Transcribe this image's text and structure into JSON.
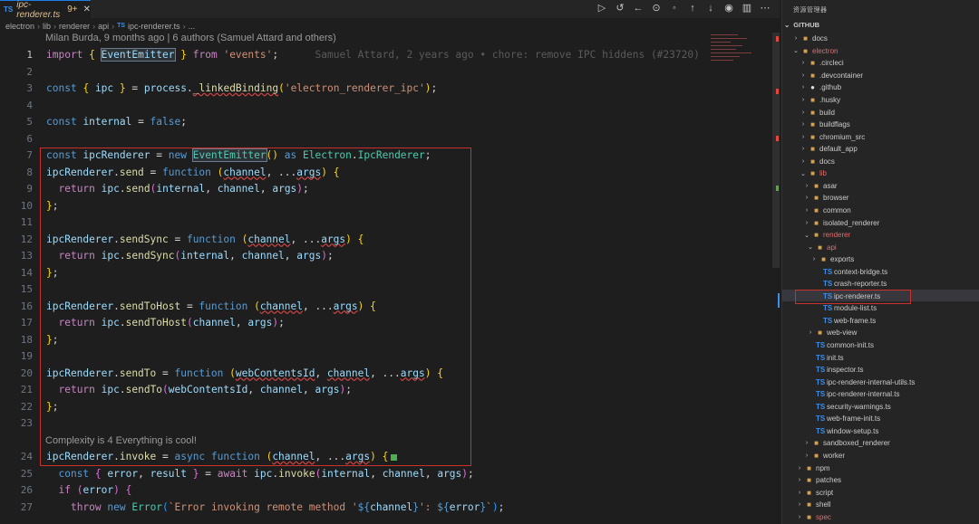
{
  "tab": {
    "file": "ipc-renderer.ts",
    "badge": "9+",
    "lang": "TS"
  },
  "breadcrumb": [
    "electron",
    "lib",
    "renderer",
    "api",
    "ipc-renderer.ts",
    "..."
  ],
  "blame_header": "Milan Burda, 9 months ago | 6 authors (Samuel Attard and others)",
  "inline_blame": "Samuel Attard, 2 years ago • chore: remove IPC hiddens (#23720)",
  "complexity_lens": "Complexity is 4 Everything is cool!",
  "line_numbers": [
    "1",
    "2",
    "3",
    "4",
    "5",
    "6",
    "7",
    "8",
    "9",
    "10",
    "11",
    "12",
    "13",
    "14",
    "15",
    "16",
    "17",
    "18",
    "19",
    "20",
    "21",
    "22",
    "23",
    "24",
    "25",
    "26",
    "27"
  ],
  "explorer": {
    "title": "资源管理器",
    "section": "GITHUB",
    "items": [
      {
        "label": "docs",
        "type": "folder"
      },
      {
        "label": "electron",
        "type": "folder-open"
      },
      {
        "label": ".circleci",
        "type": "folder"
      },
      {
        "label": ".devcontainer",
        "type": "folder"
      },
      {
        "label": ".github",
        "type": "github"
      },
      {
        "label": ".husky",
        "type": "folder"
      },
      {
        "label": "build",
        "type": "folder"
      },
      {
        "label": "buildflags",
        "type": "folder"
      },
      {
        "label": "chromium_src",
        "type": "folder"
      },
      {
        "label": "default_app",
        "type": "folder"
      },
      {
        "label": "docs",
        "type": "folder"
      },
      {
        "label": "lib",
        "type": "folder-open"
      },
      {
        "label": "asar",
        "type": "folder"
      },
      {
        "label": "browser",
        "type": "folder"
      },
      {
        "label": "common",
        "type": "folder"
      },
      {
        "label": "isolated_renderer",
        "type": "folder"
      },
      {
        "label": "renderer",
        "type": "folder-open"
      },
      {
        "label": "api",
        "type": "folder-open"
      },
      {
        "label": "exports",
        "type": "folder"
      },
      {
        "label": "context-bridge.ts",
        "type": "ts"
      },
      {
        "label": "crash-reporter.ts",
        "type": "ts"
      },
      {
        "label": "ipc-renderer.ts",
        "type": "ts"
      },
      {
        "label": "module-list.ts",
        "type": "ts"
      },
      {
        "label": "web-frame.ts",
        "type": "ts"
      },
      {
        "label": "web-view",
        "type": "folder"
      },
      {
        "label": "common-init.ts",
        "type": "ts"
      },
      {
        "label": "init.ts",
        "type": "ts"
      },
      {
        "label": "inspector.ts",
        "type": "ts"
      },
      {
        "label": "ipc-renderer-internal-utils.ts",
        "type": "ts"
      },
      {
        "label": "ipc-renderer-internal.ts",
        "type": "ts"
      },
      {
        "label": "security-warnings.ts",
        "type": "ts"
      },
      {
        "label": "web-frame-init.ts",
        "type": "ts"
      },
      {
        "label": "window-setup.ts",
        "type": "ts"
      },
      {
        "label": "sandboxed_renderer",
        "type": "folder"
      },
      {
        "label": "worker",
        "type": "folder"
      },
      {
        "label": "npm",
        "type": "folder"
      },
      {
        "label": "patches",
        "type": "folder"
      },
      {
        "label": "script",
        "type": "folder"
      },
      {
        "label": "shell",
        "type": "folder"
      },
      {
        "label": "spec",
        "type": "folder"
      }
    ]
  },
  "colors": {
    "accent": "#3b8eea",
    "highlight_box": "#c8312c",
    "folder": "#d8a04a"
  },
  "icons": [
    "play-icon",
    "history-icon",
    "back-icon",
    "git-compare-icon",
    "circle-dot-icon",
    "arrow-up-icon",
    "arrow-down-icon",
    "dot-icon",
    "split-icon",
    "more-icon"
  ]
}
